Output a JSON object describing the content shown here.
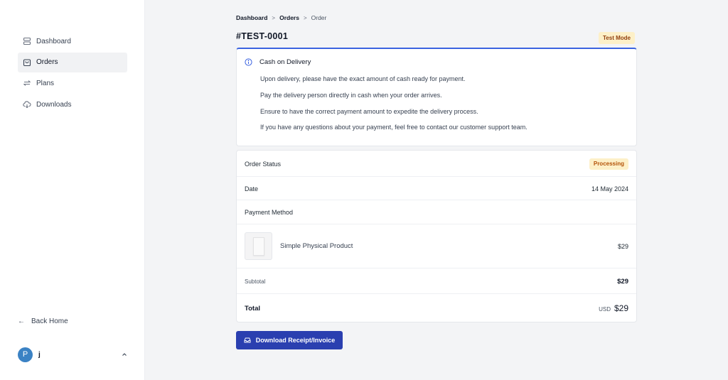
{
  "sidebar": {
    "items": [
      {
        "label": "Dashboard",
        "icon": "dashboard-icon",
        "active": false
      },
      {
        "label": "Orders",
        "icon": "bag-icon",
        "active": true
      },
      {
        "label": "Plans",
        "icon": "repeat-icon",
        "active": false
      },
      {
        "label": "Downloads",
        "icon": "cloud-download-icon",
        "active": false
      }
    ],
    "back_home": "Back Home",
    "user": {
      "initial": "P",
      "name": "j"
    }
  },
  "breadcrumb": {
    "items": [
      "Dashboard",
      "Orders",
      "Order"
    ]
  },
  "order": {
    "title": "#TEST-0001",
    "mode_badge": "Test Mode"
  },
  "notice": {
    "title": "Cash on Delivery",
    "lines": [
      "Upon delivery, please have the exact amount of cash ready for payment.",
      "Pay the delivery person directly in cash when your order arrives.",
      "Ensure to have the correct payment amount to expedite the delivery process.",
      "If you have any questions about your payment, feel free to contact our customer support team."
    ]
  },
  "details": {
    "status_label": "Order Status",
    "status_value": "Processing",
    "date_label": "Date",
    "date_value": "14 May 2024",
    "payment_label": "Payment Method",
    "product_name": "Simple Physical Product",
    "product_price": "$29",
    "subtotal_label": "Subtotal",
    "subtotal_value": "$29",
    "total_label": "Total",
    "total_currency": "USD",
    "total_value": "$29"
  },
  "actions": {
    "download_label": "Download Receipt/Invoice"
  },
  "colors": {
    "accent": "#2a3fb0",
    "notice_border": "#3b63e0",
    "badge_bg": "#fdf0c8",
    "avatar": "#3b82c4"
  }
}
